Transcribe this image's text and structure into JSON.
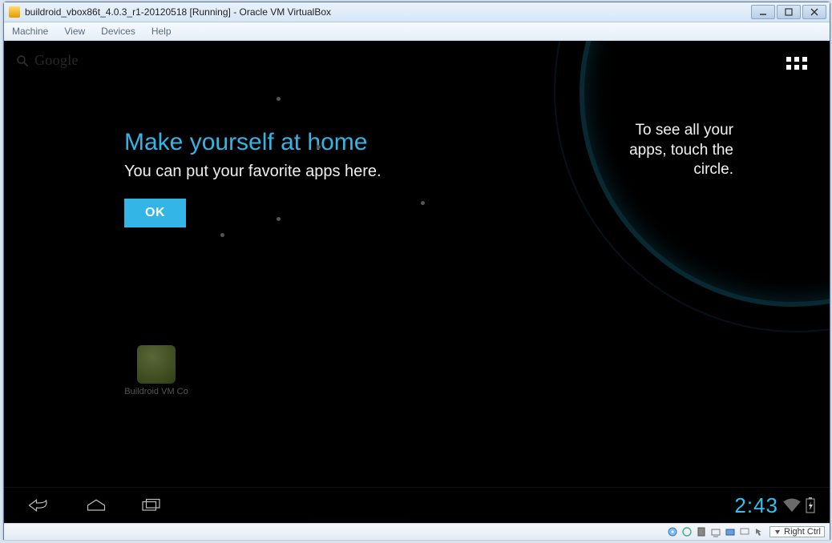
{
  "window": {
    "title": "buildroid_vbox86t_4.0.3_r1-20120518 [Running] - Oracle VM VirtualBox",
    "controls": {
      "min": "minimize",
      "max": "maximize",
      "close": "close"
    }
  },
  "menubar": [
    "Machine",
    "View",
    "Devices",
    "Help"
  ],
  "android": {
    "search_label": "Google",
    "tip_right": "To see all your apps, touch the circle.",
    "dialog": {
      "title": "Make yourself at home",
      "body": "You can put your favorite apps here.",
      "ok": "OK"
    },
    "home_app_label": "Buildroid VM Co",
    "clock": "2:43"
  },
  "statusbar": {
    "hostkey": "Right Ctrl"
  }
}
